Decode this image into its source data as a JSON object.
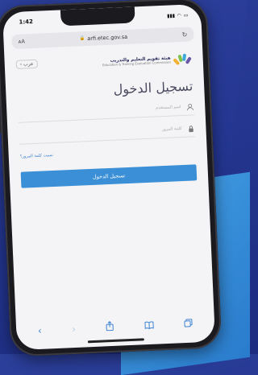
{
  "status": {
    "time": "1:42"
  },
  "browser": {
    "text_size": "ᴀA",
    "url": "arfi.etec.gov.sa"
  },
  "page": {
    "lang": "‹ عرب",
    "logo_ar": "هيئة تقويم التعليم والتدريب",
    "logo_en": "Education & Training Evaluation Commission",
    "title": "تسجيل الدخول",
    "username_placeholder": "اسم المستخدم",
    "password_placeholder": "كلمة المرور",
    "forgot_password": "نسيت كلمة المرور؟",
    "login_button": "تسجيل الدخول"
  },
  "colors": {
    "accent": "#3a8fd6",
    "background": "#243690"
  },
  "icons": [
    "back-icon",
    "forward-icon",
    "share-icon",
    "bookmarks-icon",
    "tabs-icon",
    "user-icon",
    "lock-icon",
    "reload-icon"
  ]
}
